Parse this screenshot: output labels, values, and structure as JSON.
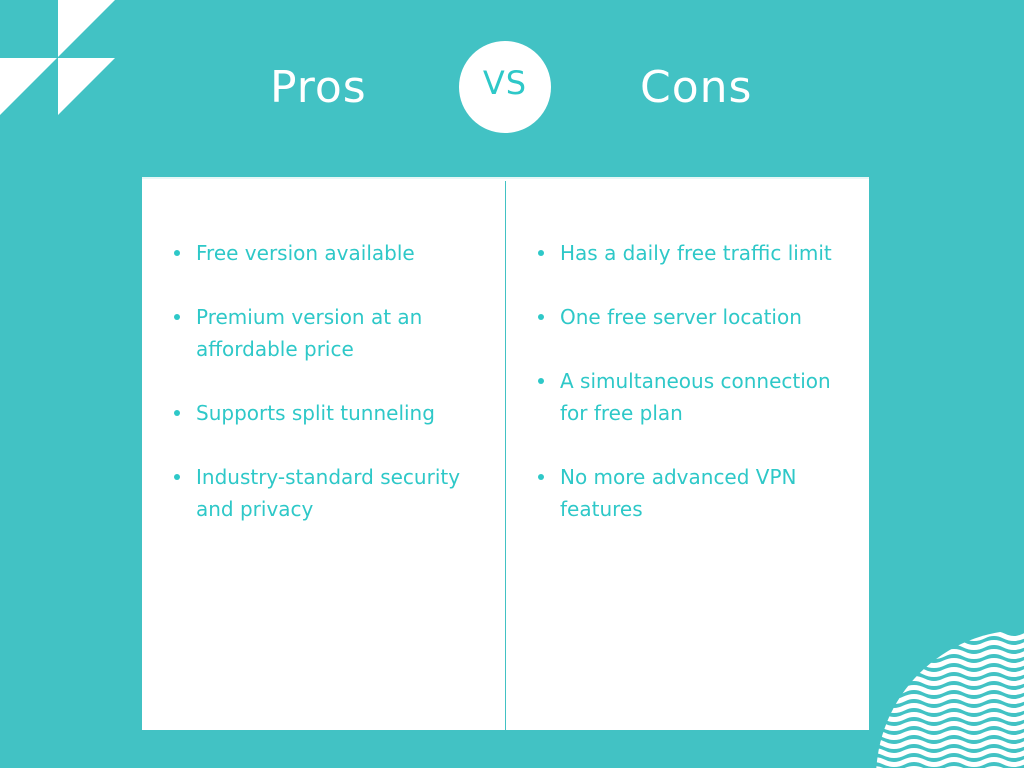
{
  "colors": {
    "background": "#42c2c4",
    "accent_text": "#2ec8c8",
    "card": "#ffffff",
    "heading_text": "#ffffff"
  },
  "header": {
    "pros_title": "Pros",
    "vs_label": "VS",
    "cons_title": "Cons"
  },
  "pros": {
    "items": [
      "Free version available",
      "Premium version at an affordable price",
      "Supports split tunneling",
      "Industry-standard security and privacy"
    ]
  },
  "cons": {
    "items": [
      "Has a daily free traffic limit",
      "One free server location",
      "A simultaneous connection for free plan",
      "No more advanced VPN features"
    ]
  },
  "decorations": {
    "top_left": "triangle-pattern",
    "bottom_right": "wave-pattern"
  }
}
